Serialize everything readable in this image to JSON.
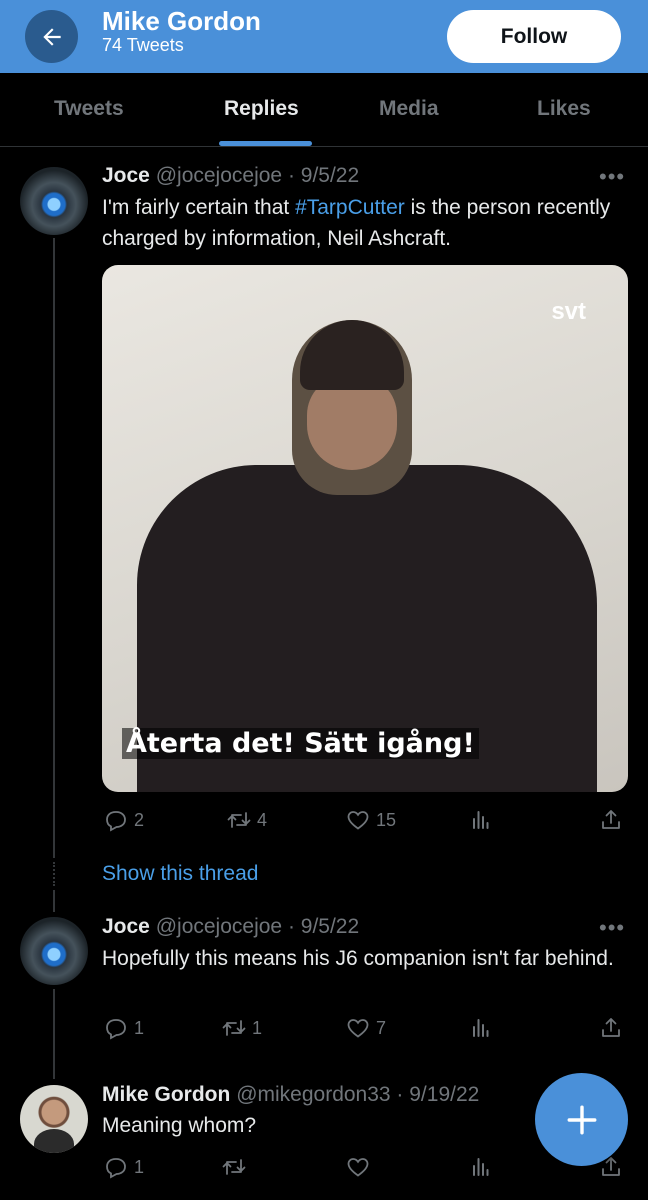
{
  "header": {
    "name": "Mike Gordon",
    "tweet_count": "74 Tweets",
    "follow_label": "Follow",
    "accent_color": "#4a90d9",
    "back_icon": "arrow-left-icon"
  },
  "tabs": [
    {
      "label": "Tweets",
      "active": false
    },
    {
      "label": "Replies",
      "active": true
    },
    {
      "label": "Media",
      "active": false
    },
    {
      "label": "Likes",
      "active": false
    }
  ],
  "tweets": [
    {
      "name": "Joce",
      "meta": "@jocejocejoe · 9/5/22",
      "text_before": "I'm fairly certain that ",
      "hashtag": "#TarpCutter",
      "text_after": " is the person recently charged by information, Neil Ashcraft.",
      "media": {
        "logo": "svt",
        "subtitle": "Återta det! Sätt igång!"
      },
      "replies": "2",
      "retweets": "4",
      "likes": "15"
    },
    {
      "name": "Joce",
      "meta": "@jocejocejoe · 9/5/22",
      "text": "Hopefully this means his J6 companion isn't far behind.",
      "replies": "1",
      "retweets": "1",
      "likes": "7"
    },
    {
      "name": "Mike Gordon",
      "meta": "@mikegordon33 · 9/19/22",
      "text": "Meaning whom?",
      "replies": "1",
      "retweets": "",
      "likes": ""
    }
  ],
  "show_thread_label": "Show this thread",
  "more_glyph": "•••",
  "compose_icon": "plus-icon"
}
